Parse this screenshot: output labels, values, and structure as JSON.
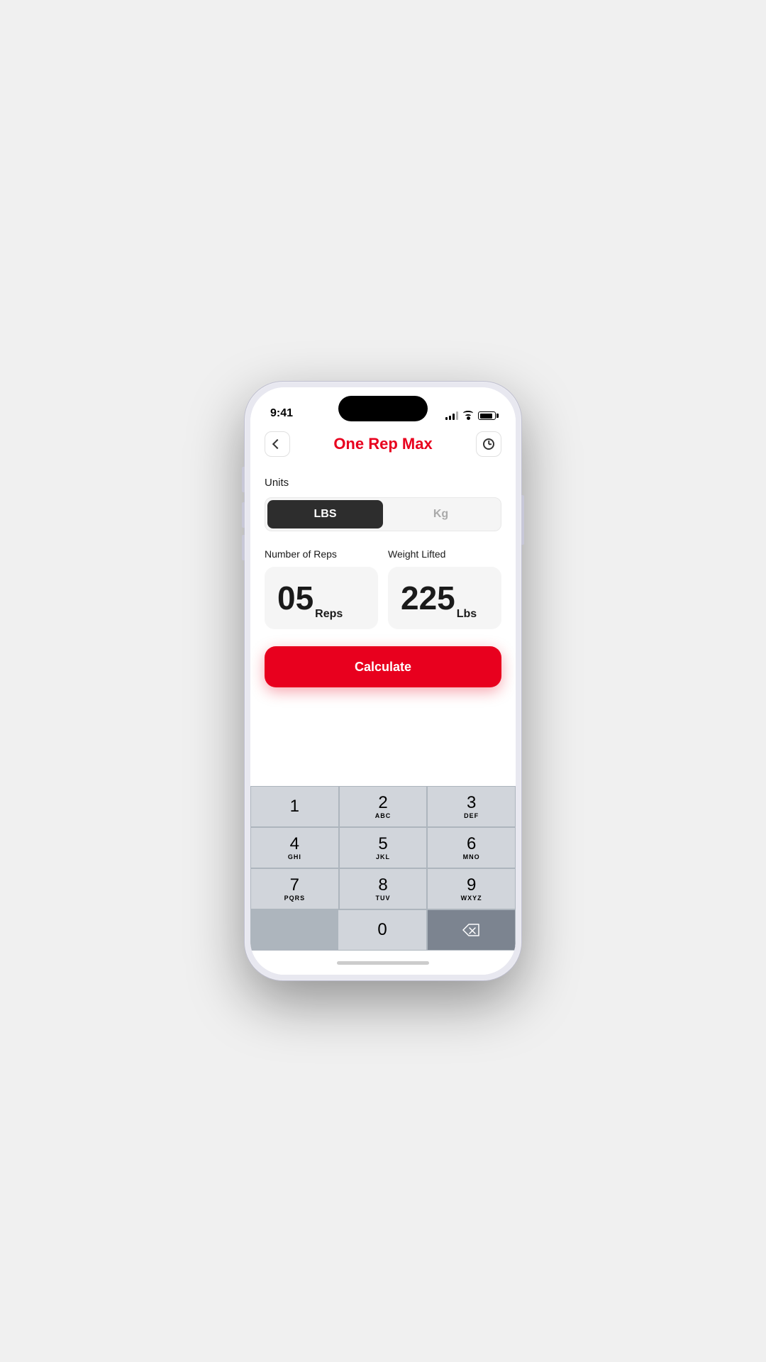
{
  "status_bar": {
    "time": "9:41"
  },
  "header": {
    "title": "One Rep Max",
    "back_label": "‹",
    "history_label": "🕐"
  },
  "units": {
    "label": "Units",
    "lbs_label": "LBS",
    "kg_label": "Kg",
    "active": "LBS"
  },
  "inputs": {
    "reps_label": "Number of Reps",
    "weight_label": "Weight Lifted",
    "reps_value": "05",
    "reps_unit": "Reps",
    "weight_value": "225",
    "weight_unit": "Lbs"
  },
  "calculate_button": {
    "label": "Calculate"
  },
  "keyboard": {
    "rows": [
      [
        {
          "number": "1",
          "letters": ""
        },
        {
          "number": "2",
          "letters": "ABC"
        },
        {
          "number": "3",
          "letters": "DEF"
        }
      ],
      [
        {
          "number": "4",
          "letters": "GHI"
        },
        {
          "number": "5",
          "letters": "JKL"
        },
        {
          "number": "6",
          "letters": "MNO"
        }
      ],
      [
        {
          "number": "7",
          "letters": "PQRS"
        },
        {
          "number": "8",
          "letters": "TUV"
        },
        {
          "number": "9",
          "letters": "WXYZ"
        }
      ]
    ],
    "zero": "0",
    "delete_aria": "delete"
  },
  "colors": {
    "accent_red": "#e8001e",
    "dark_bg": "#2d2d2d",
    "key_dark": "#7c8490",
    "key_light": "#d1d5db"
  }
}
